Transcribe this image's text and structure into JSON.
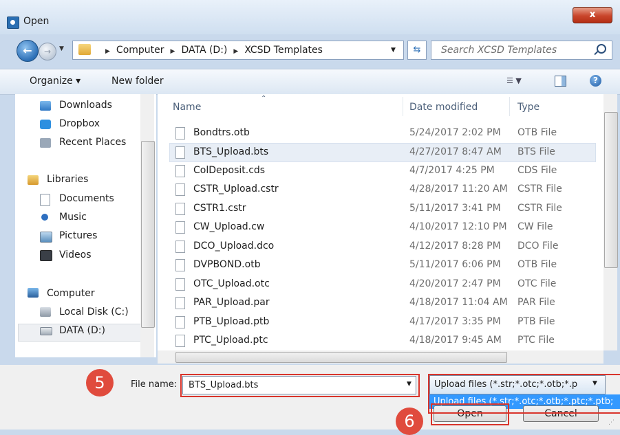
{
  "window": {
    "title": "Open",
    "close_label": "x"
  },
  "address": {
    "crumbs": [
      "Computer",
      "DATA (D:)",
      "XCSD Templates"
    ],
    "search_placeholder": "Search XCSD Templates"
  },
  "toolbar": {
    "organize_label": "Organize ▾",
    "new_folder_label": "New folder"
  },
  "nav": {
    "items": [
      {
        "label": "Downloads"
      },
      {
        "label": "Dropbox"
      },
      {
        "label": "Recent Places"
      },
      {
        "label": "Libraries"
      },
      {
        "label": "Documents"
      },
      {
        "label": "Music"
      },
      {
        "label": "Pictures"
      },
      {
        "label": "Videos"
      },
      {
        "label": "Computer"
      },
      {
        "label": "Local Disk (C:)"
      },
      {
        "label": "DATA (D:)"
      }
    ]
  },
  "files": {
    "headers": {
      "name": "Name",
      "date": "Date modified",
      "type": "Type"
    },
    "rows": [
      {
        "name": "Bondtrs.otb",
        "date": "5/24/2017 2:02 PM",
        "type": "OTB File"
      },
      {
        "name": "BTS_Upload.bts",
        "date": "4/27/2017 8:47 AM",
        "type": "BTS File"
      },
      {
        "name": "ColDeposit.cds",
        "date": "4/7/2017 4:25 PM",
        "type": "CDS File"
      },
      {
        "name": "CSTR_Upload.cstr",
        "date": "4/28/2017 11:20 AM",
        "type": "CSTR File"
      },
      {
        "name": "CSTR1.cstr",
        "date": "5/11/2017 3:41 PM",
        "type": "CSTR File"
      },
      {
        "name": "CW_Upload.cw",
        "date": "4/10/2017 12:10 PM",
        "type": "CW File"
      },
      {
        "name": "DCO_Upload.dco",
        "date": "4/12/2017 8:28 PM",
        "type": "DCO File"
      },
      {
        "name": "DVPBOND.otb",
        "date": "5/11/2017 6:06 PM",
        "type": "OTB File"
      },
      {
        "name": "OTC_Upload.otc",
        "date": "4/20/2017 2:47 PM",
        "type": "OTC File"
      },
      {
        "name": "PAR_Upload.par",
        "date": "4/18/2017 11:04 AM",
        "type": "PAR File"
      },
      {
        "name": "PTB_Upload.ptb",
        "date": "4/17/2017 3:35 PM",
        "type": "PTB File"
      },
      {
        "name": "PTC_Upload.ptc",
        "date": "4/18/2017 9:45 AM",
        "type": "PTC File"
      }
    ]
  },
  "bottom": {
    "filename_label": "File name:",
    "filename_value": "BTS_Upload.bts",
    "filetype_value": "Upload files (*.str;*.otc;*.otb;*.p",
    "filetype_option": "Upload files (*.str;*.otc;*.otb;*.ptc;*.ptb;",
    "open_label": "Open",
    "cancel_label": "Cancel"
  },
  "annotations": {
    "step_filename": "5",
    "step_open": "6"
  },
  "colors": {
    "accent": "#3399ff",
    "highlight": "#d9342b",
    "step_badge": "#e04b3d"
  }
}
